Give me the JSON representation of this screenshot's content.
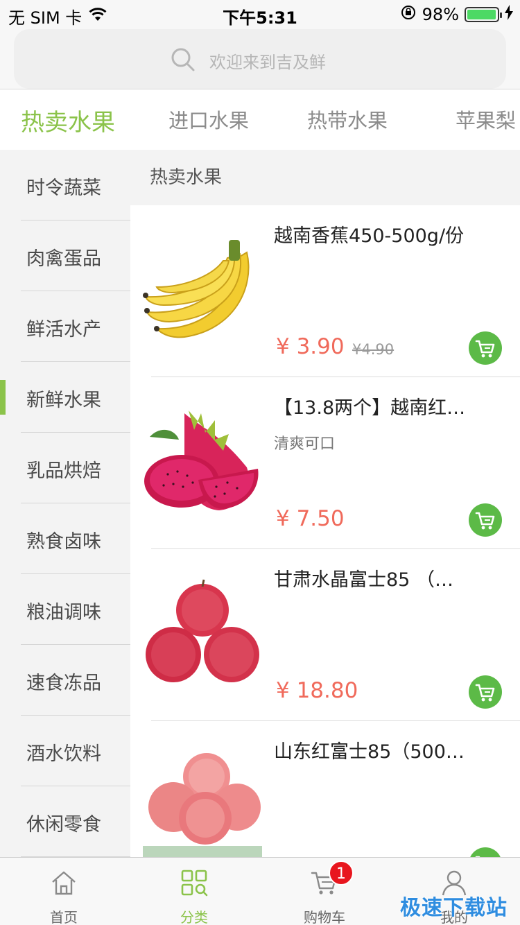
{
  "status_bar": {
    "carrier": "无 SIM 卡",
    "time": "下午5:31",
    "battery": "98%",
    "battery_level": 0.98,
    "battery_color": "#4cd964"
  },
  "search": {
    "placeholder": "欢迎来到吉及鲜"
  },
  "top_tabs": [
    {
      "label": "热卖水果",
      "active": true
    },
    {
      "label": "进口水果",
      "active": false
    },
    {
      "label": "热带水果",
      "active": false
    },
    {
      "label": "苹果梨",
      "active": false
    }
  ],
  "sidebar": {
    "items": [
      {
        "label": "时令蔬菜"
      },
      {
        "label": "肉禽蛋品"
      },
      {
        "label": "鲜活水产"
      },
      {
        "label": "新鲜水果",
        "active": true
      },
      {
        "label": "乳品烘焙"
      },
      {
        "label": "熟食卤味"
      },
      {
        "label": "粮油调味"
      },
      {
        "label": "速食冻品"
      },
      {
        "label": "酒水饮料"
      },
      {
        "label": "休闲零食"
      }
    ]
  },
  "content": {
    "section_title": "热卖水果",
    "products": [
      {
        "name": "越南香蕉450-500g/份",
        "desc": "",
        "price": "¥ 3.90",
        "old_price": "¥4.90",
        "image": "banana"
      },
      {
        "name": "【13.8两个】越南红…",
        "desc": "清爽可口",
        "price": "¥ 7.50",
        "old_price": "",
        "image": "dragon-fruit"
      },
      {
        "name": "甘肃水晶富士85 （…",
        "desc": "",
        "price": "¥ 18.80",
        "old_price": "",
        "image": "apple-red"
      },
      {
        "name": "山东红富士85（500…",
        "desc": "",
        "price": "",
        "old_price": "",
        "image": "apple-pink"
      }
    ]
  },
  "tab_bar": {
    "items": [
      {
        "label": "首页",
        "icon": "home-icon"
      },
      {
        "label": "分类",
        "icon": "category-icon",
        "active": true
      },
      {
        "label": "购物车",
        "icon": "cart-icon",
        "badge": "1"
      },
      {
        "label": "我的",
        "icon": "profile-icon"
      }
    ]
  },
  "watermark": "极速下载站",
  "colors": {
    "accent": "#8bc34a",
    "price": "#f06a5b",
    "cart_button": "#5cba47",
    "badge": "#e8161e"
  }
}
